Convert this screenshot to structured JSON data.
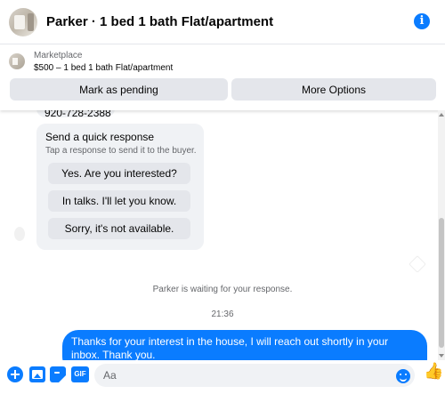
{
  "header": {
    "title": "Parker · 1 bed 1 bath Flat/apartment",
    "avatar_icon": "house-photo-avatar",
    "info_icon": "info-icon"
  },
  "listing": {
    "source_label": "Marketplace",
    "item_label": "$500 – 1 bed 1 bath Flat/apartment",
    "thumbnail_icon": "house-thumbnail-icon",
    "buttons": {
      "pending": "Mark as pending",
      "more_options": "More Options"
    }
  },
  "chat": {
    "phone": "920-728-2388",
    "quick_response": {
      "title": "Send a quick response",
      "subtitle": "Tap a response to send it to the buyer.",
      "options": [
        "Yes. Are you interested?",
        "In talks. I'll let you know.",
        "Sorry, it's not available."
      ]
    },
    "waiting_text": "Parker is waiting for your response.",
    "time": "21:36",
    "outgoing_message": "Thanks for your interest in the house, I will reach out shortly in your inbox. Thank you."
  },
  "composer": {
    "placeholder": "Aa",
    "value": "",
    "gif_label": "GIF",
    "icons": {
      "add": "plus-icon",
      "image": "image-icon",
      "sticker": "sticker-icon",
      "gif": "gif-icon",
      "emoji": "emoji-icon",
      "like": "thumbs-up-icon"
    }
  },
  "colors": {
    "accent": "#0a7cff",
    "bubble_bg": "#f0f2f5",
    "button_bg": "#e4e6eb",
    "muted_text": "#65676b"
  }
}
